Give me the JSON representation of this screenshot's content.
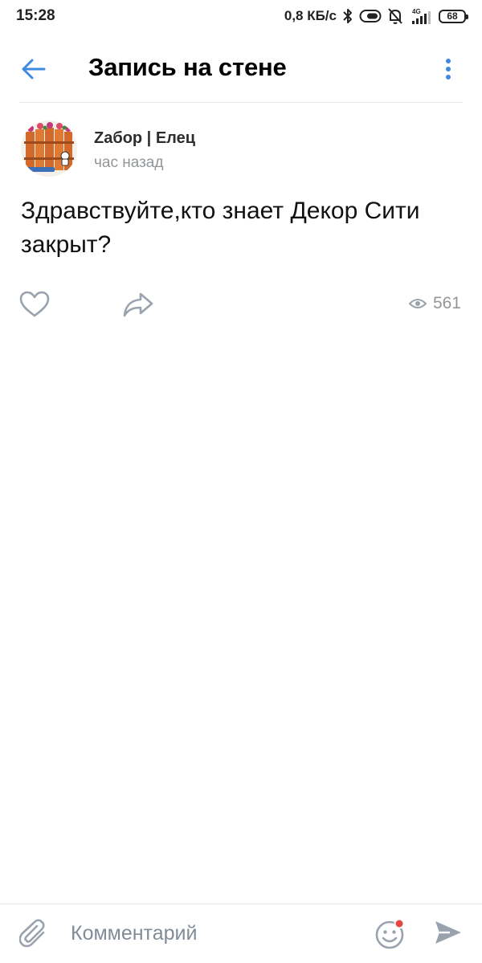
{
  "status_bar": {
    "time": "15:28",
    "network_speed": "0,8 КБ/с",
    "network_type": "4G",
    "battery": "68",
    "icons": [
      "bluetooth-icon",
      "toggle-icon",
      "muted-bell-icon",
      "signal-icon",
      "battery-icon"
    ]
  },
  "header": {
    "title": "Запись на стене",
    "back_icon": "arrow-left-icon",
    "more_icon": "more-vertical-icon"
  },
  "post": {
    "author_name": "Zабор | Елец",
    "time": "час назад",
    "text": "Здравствуйте,кто знает Декор Сити закрыт?",
    "views": "561",
    "icons": [
      "heart-icon",
      "share-icon",
      "eye-icon"
    ]
  },
  "comment_bar": {
    "placeholder": "Комментарий",
    "icons": [
      "paperclip-icon",
      "smiley-icon",
      "send-icon"
    ]
  },
  "colors": {
    "accent": "#3f8ae0",
    "secondary_text": "#939699",
    "icon_gray": "#99a2ad",
    "notification_dot": "#e64646"
  }
}
